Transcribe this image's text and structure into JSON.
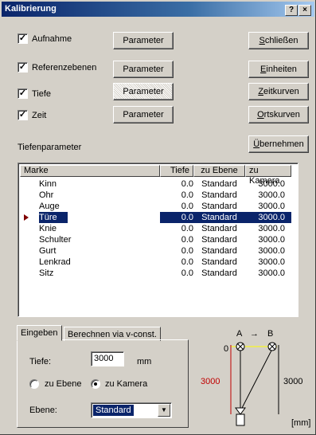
{
  "window": {
    "title": "Kalibrierung",
    "help_label": "?",
    "close_label": "×"
  },
  "checks": [
    {
      "label": "Aufnahme",
      "checked": true,
      "mark": "✓"
    },
    {
      "label": "Referenzebenen",
      "checked": true,
      "mark": "✓"
    },
    {
      "label": "Tiefe",
      "checked": true,
      "mark": "✓"
    },
    {
      "label": "Zeit",
      "checked": true,
      "mark": "✓"
    }
  ],
  "param_button_label": "Parameter",
  "right_buttons": [
    {
      "accel": "S",
      "rest": "chließen"
    },
    {
      "accel": "E",
      "rest": "inheiten"
    },
    {
      "accel": "Z",
      "rest": "eitkurven"
    },
    {
      "accel": "O",
      "rest": "rtskurven"
    }
  ],
  "section_label": "Tiefenparameter",
  "apply_button": {
    "accel": "Ü",
    "rest": "bernehmen"
  },
  "table": {
    "columns": [
      "Marke",
      "Tiefe",
      "zu Ebene",
      "zu Kamera"
    ],
    "rows": [
      [
        "Kinn",
        "0.0",
        "Standard",
        "3000.0"
      ],
      [
        "Ohr",
        "0.0",
        "Standard",
        "3000.0"
      ],
      [
        "Auge",
        "0.0",
        "Standard",
        "3000.0"
      ],
      [
        "Türe",
        "0.0",
        "Standard",
        "3000.0"
      ],
      [
        "Knie",
        "0.0",
        "Standard",
        "3000.0"
      ],
      [
        "Schulter",
        "0.0",
        "Standard",
        "3000.0"
      ],
      [
        "Gurt",
        "0.0",
        "Standard",
        "3000.0"
      ],
      [
        "Lenkrad",
        "0.0",
        "Standard",
        "3000.0"
      ],
      [
        "Sitz",
        "0.0",
        "Standard",
        "3000.0"
      ]
    ],
    "selected_row": "Türe"
  },
  "tabs": [
    "Eingeben",
    "Berechnen via v-const."
  ],
  "form": {
    "depth_label": "Tiefe:",
    "depth_value": "3000",
    "depth_unit": "mm",
    "radio_plane": "zu Ebene",
    "radio_camera": "zu Kamera",
    "selected_radio": "zu Kamera",
    "plane_label": "Ebene:",
    "plane_value": "Standard"
  },
  "diagram": {
    "label_a": "A",
    "arrow": "→",
    "label_b": "B",
    "zero": "0",
    "left_value": "3000",
    "right_value": "3000",
    "unit": "[mm]",
    "accent_color": "#c00000"
  }
}
